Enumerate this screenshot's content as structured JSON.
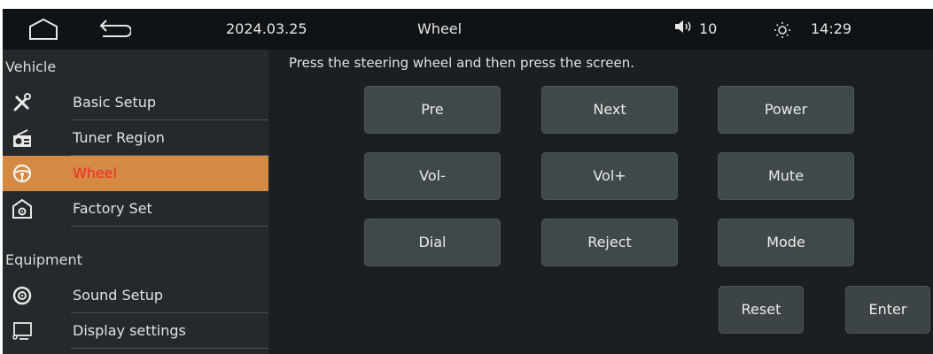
{
  "status_bar": {
    "home_icon": "home-icon",
    "back_icon": "back-icon",
    "date": "2024.03.25",
    "title": "Wheel",
    "volume_icon": "speaker-icon",
    "volume": "10",
    "brightness_icon": "sun-icon",
    "time": "14:29"
  },
  "sidebar": {
    "sections": [
      {
        "header": "Vehicle",
        "items": [
          {
            "label": "Basic Setup",
            "icon": "tools-icon",
            "active": false
          },
          {
            "label": "Tuner Region",
            "icon": "radio-icon",
            "active": false
          },
          {
            "label": "Wheel",
            "icon": "steering-wheel-icon",
            "active": true
          },
          {
            "label": "Factory Set",
            "icon": "factory-settings-icon",
            "active": false
          }
        ]
      },
      {
        "header": "Equipment",
        "items": [
          {
            "label": "Sound Setup",
            "icon": "speaker-icon",
            "active": false
          },
          {
            "label": "Display settings",
            "icon": "display-icon",
            "active": false
          }
        ]
      }
    ]
  },
  "main": {
    "instruction": "Press the steering wheel and then press the screen.",
    "wheel_buttons": [
      "Pre",
      "Next",
      "Power",
      "Vol-",
      "Vol+",
      "Mute",
      "Dial",
      "Reject",
      "Mode"
    ],
    "reset_label": "Reset",
    "enter_label": "Enter"
  },
  "colors": {
    "active_item_bg": "#d48a42",
    "active_item_text": "#ef2b2b",
    "button_bg": "#40494a",
    "background": "#1b1f22"
  }
}
